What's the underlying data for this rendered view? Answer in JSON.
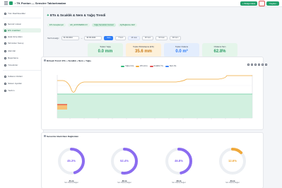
{
  "topbar": {
    "breadcrumb": "› TK Ponton — Sensöre Tabloekmaları",
    "primary_action": "+ Widget Ekle",
    "save_label": "Kaydet"
  },
  "sidebar": {
    "items": [
      {
        "label": "Tüm Dashboardlar",
        "active": false
      },
      {
        "label": "Sensör Listesi",
        "active": false
      },
      {
        "label": "ETo Analizleri",
        "active": true
      },
      {
        "label": "Hata Giriş Alanı",
        "active": false
      },
      {
        "label": "Tahminler Sonuç",
        "active": false
      },
      {
        "label": "Alarmlar",
        "active": false
      },
      {
        "label": "Raporlama",
        "active": false
      },
      {
        "label": "Yönetimler",
        "active": false
      },
      {
        "label": "Kullanıcı Rolleri",
        "active": false
      },
      {
        "label": "Sistem Ayarları",
        "active": false
      },
      {
        "label": "Yardım",
        "active": false
      }
    ]
  },
  "main": {
    "title": "ETo & Sıcaklık & Nem & Yağış Trendi",
    "title_glyph": "✦",
    "chips": [
      "ETo hesaplanıyor",
      "HD_HFP4/SE800-CV",
      "Yağış Sensörleri Güncel",
      "Ağ Bağlantısı Aktif"
    ],
    "filters": {
      "label": "Tarih Aralığı:",
      "start": "01.09.2024",
      "end": "30.09.2024",
      "periods": [
        "Gün",
        "7 Gün",
        "15 Gün",
        "30 Gün",
        "60 Gün",
        "90 Gün"
      ],
      "active_period": "Gün"
    },
    "stats": [
      {
        "label": "Toplam Yağış",
        "value": "0.0 mm",
        "color": "#2f9e67",
        "bg": "#e4f5ea"
      },
      {
        "label": "Toplam Buharlaşma (ETo)",
        "value": "35.6 mm",
        "color": "#c97a16",
        "bg": "#fdf0d9"
      },
      {
        "label": "Toplam Sulama",
        "value": "0.0 m³",
        "color": "#2f7df6",
        "bg": "#e3edfd"
      },
      {
        "label": "Ortalama Nem",
        "value": "62.8%",
        "color": "#2f9e67",
        "bg": "#e4f5ea"
      }
    ]
  },
  "trend_card": {
    "title": "Birleşik Trend: ETo + Sıcaklık + Nem + Yağış",
    "legend": [
      {
        "label": "Yağış (mm)",
        "color": "#2fb67a"
      },
      {
        "label": "ETo (mm)",
        "color": "#f0a93a"
      },
      {
        "label": "Sıcaklık (°C)",
        "color": "#e05252"
      },
      {
        "label": "Nem (%)",
        "color": "#3b82f6"
      }
    ],
    "toolbox_icons": [
      "zoom-in-icon",
      "zoom-out-icon",
      "pan-icon",
      "reset-icon",
      "download-icon",
      "menu-icon"
    ]
  },
  "gauges_card": {
    "title": "Sensörler Bazlı Nem Dağılımları",
    "gauges": [
      {
        "percent": "45.3%",
        "fraction": 0.453,
        "name": "Z1-nt",
        "sub": "Son Okuma Değeri",
        "color": "#8b6cf0"
      },
      {
        "percent": "52.4%",
        "fraction": 0.524,
        "name": "Z2-nt",
        "sub": "Son Okuma Değeri",
        "color": "#8b6cf0"
      },
      {
        "percent": "46.8%",
        "fraction": 0.468,
        "name": "Z3-nt",
        "sub": "Son Okuma Değeri",
        "color": "#8b6cf0"
      },
      {
        "percent": "12.6%",
        "fraction": 0.126,
        "name": "Z4-nt",
        "sub": "Son Okuma Değeri",
        "color": "#f0a93a"
      }
    ]
  }
}
